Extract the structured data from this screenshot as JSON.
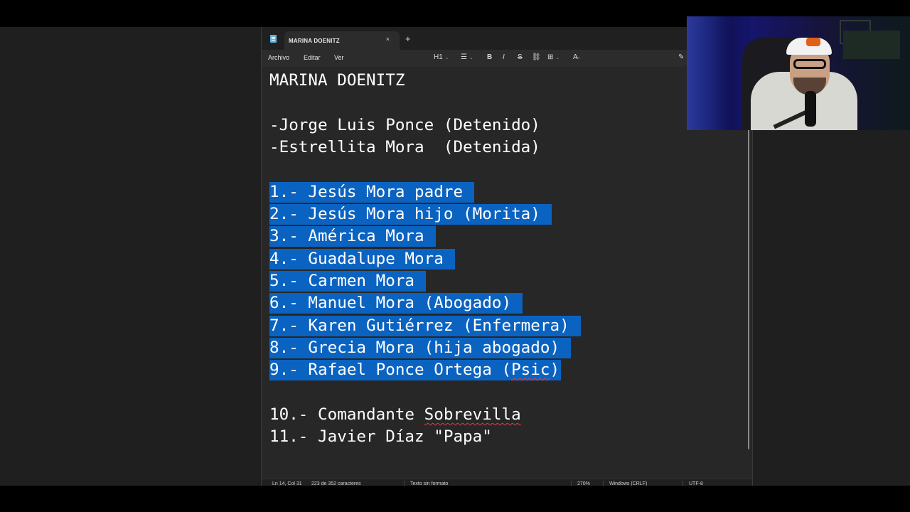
{
  "tab": {
    "title": "MARINA DOENITZ",
    "close": "×",
    "new_tab": "+"
  },
  "menu": {
    "file": "Archivo",
    "edit": "Editar",
    "view": "Ver"
  },
  "toolbar": {
    "heading": "H1",
    "bold": "B",
    "italic": "I",
    "strike": "S"
  },
  "document": {
    "lines": [
      "MARINA DOENITZ",
      "",
      "-Jorge Luis Ponce (Detenido)",
      "-Estrellita Mora  (Detenida)",
      "",
      "1.- Jesús Mora padre",
      "2.- Jesús Mora hijo (Morita)",
      "3.- América Mora",
      "4.- Guadalupe Mora",
      "5.- Carmen Mora",
      "6.- Manuel Mora (Abogado)",
      "7.- Karen Gutiérrez (Enfermera)",
      "8.- Grecia Mora (hija abogado)",
      "9.- Rafael Ponce Ortega (Psic)",
      "",
      "10.- Comandante Sobrevilla",
      "11.- Javier Díaz \"Papa\""
    ],
    "line9_prefix": "9.- Rafael Ponce Ortega (",
    "line9_word": "Psic",
    "line9_suffix": ")",
    "line10_prefix": "10.- Comandante ",
    "line10_word": "Sobrevilla"
  },
  "status": {
    "position": "Ln 14, Col 31",
    "chars": "223 de 352 caracteres",
    "format": "Texto sin formato",
    "zoom": "270%",
    "line_ending": "Windows (CRLF)",
    "encoding": "UTF-8"
  },
  "colors": {
    "selection": "#0b63c1",
    "editor_bg": "#272727",
    "text": "#ffffff"
  }
}
